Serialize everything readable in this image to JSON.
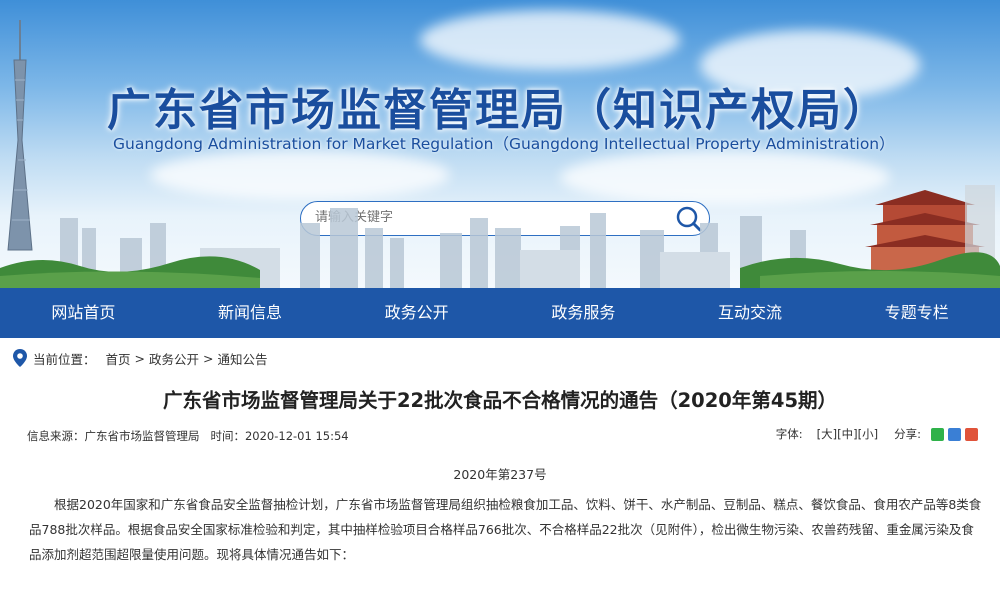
{
  "header": {
    "title_cn": "广东省市场监督管理局（知识产权局）",
    "title_en": "Guangdong Administration for Market Regulation（Guangdong Intellectual Property Administration）",
    "search_placeholder": "请输入关键字",
    "search_icon": "search-icon"
  },
  "nav": {
    "items": [
      {
        "label": "网站首页"
      },
      {
        "label": "新闻信息"
      },
      {
        "label": "政务公开"
      },
      {
        "label": "政务服务"
      },
      {
        "label": "互动交流"
      },
      {
        "label": "专题专栏"
      }
    ]
  },
  "breadcrumb": {
    "prefix": "当前位置：",
    "items": [
      "首页",
      "政务公开",
      "通知公告"
    ],
    "separator": ">"
  },
  "article": {
    "title": "广东省市场监督管理局关于22批次食品不合格情况的通告（2020年第45期）",
    "source_label": "信息来源：",
    "source": "广东省市场监督管理局",
    "time_label": "时间：",
    "time": "2020-12-01 15:54",
    "font_label": "字体:",
    "font_sizes": [
      "[大]",
      "[中]",
      "[小]"
    ],
    "share_label": "分享:",
    "doc_number": "2020年第237号",
    "paragraph": "根据2020年国家和广东省食品安全监督抽检计划，广东省市场监督管理局组织抽检粮食加工品、饮料、饼干、水产制品、豆制品、糕点、餐饮食品、食用农产品等8类食品788批次样品。根据食品安全国家标准检验和判定，其中抽样检验项目合格样品766批次、不合格样品22批次（见附件），检出微生物污染、农兽药残留、重金属污染及食品添加剂超范围超限量使用问题。现将具体情况通告如下："
  },
  "colors": {
    "nav_bg": "#1e57a8",
    "title_blue": "#1a4e9e"
  }
}
